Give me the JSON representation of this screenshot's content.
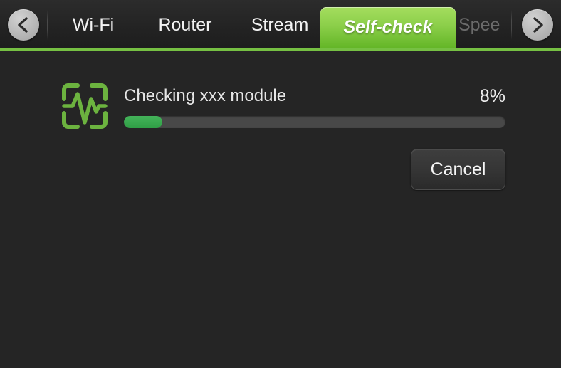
{
  "tabbar": {
    "prev_arrow": "chevron-left",
    "next_arrow": "chevron-right",
    "tabs": [
      {
        "label": "Wi-Fi",
        "active": false,
        "partial": false
      },
      {
        "label": "Router",
        "active": false,
        "partial": false
      },
      {
        "label": "Stream",
        "active": false,
        "partial": false
      },
      {
        "label": "Self-check",
        "active": true,
        "partial": false
      },
      {
        "label": "Spee",
        "active": false,
        "partial": true
      }
    ],
    "accent_color": "#76c043"
  },
  "selfcheck": {
    "icon": "pulse-monitor-icon",
    "status_text": "Checking xxx module",
    "percent_label": "8%",
    "progress_value": 8,
    "progress_fill_color": "#2f9e45",
    "progress_track_color": "#484848",
    "cancel_label": "Cancel"
  }
}
